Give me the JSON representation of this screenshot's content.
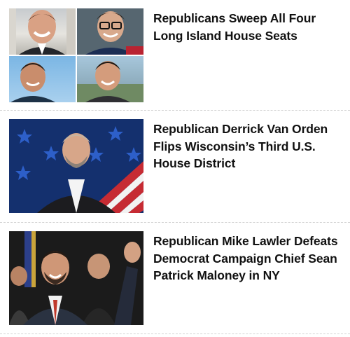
{
  "articles": [
    {
      "headline": "Republicans Sweep All Four Long Island House Seats",
      "image_icon": "portrait-collage-icon"
    },
    {
      "headline": "Republican Derrick Van Orden Flips Wisconsin’s Third U.S. House District",
      "image_icon": "portrait-photo-icon"
    },
    {
      "headline": "Republican Mike Lawler Defeats Democrat Campaign Chief Sean Patrick Maloney in NY",
      "image_icon": "celebration-photo-icon"
    }
  ],
  "colors": {
    "headline": "#111111",
    "divider": "#d4d4d4",
    "flag_blue": "#14306e",
    "flag_red": "#c62b33"
  }
}
